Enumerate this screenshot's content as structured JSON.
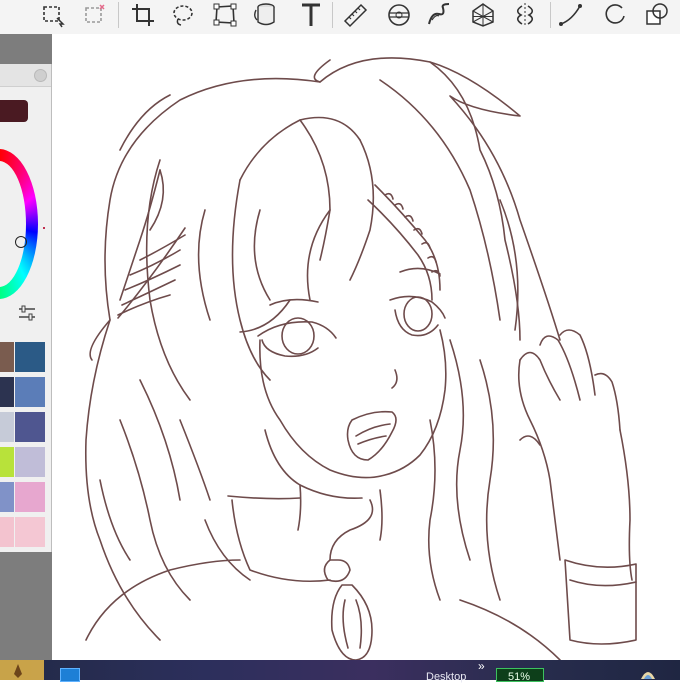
{
  "toolbar": {
    "tools": [
      {
        "icon": "rectangle-select-icon"
      },
      {
        "icon": "rectangle-select-add-icon"
      },
      {
        "icon": "crop-icon"
      },
      {
        "icon": "lasso-select-icon"
      },
      {
        "icon": "transform-icon"
      },
      {
        "icon": "fill-bucket-icon"
      },
      {
        "icon": "text-icon"
      },
      {
        "icon": "ruler-icon"
      },
      {
        "icon": "ellipse-guide-icon"
      },
      {
        "icon": "curve-guide-icon"
      },
      {
        "icon": "perspective-guide-icon"
      },
      {
        "icon": "symmetry-icon"
      },
      {
        "icon": "stroke-icon"
      },
      {
        "icon": "circle-shape-icon"
      },
      {
        "icon": "layers-icon"
      }
    ]
  },
  "color_panel": {
    "current_color": "#4a1a22",
    "swatches": [
      [
        "#7a5c4f",
        "#2b5a86"
      ],
      [
        "#2c3350",
        "#5b7db8"
      ],
      [
        "#c6cbd8",
        "#4f5690"
      ],
      [
        "#b8e23a",
        "#c0bdd8"
      ],
      [
        "#8092c8",
        "#e7a7cf"
      ],
      [
        "#f3c3cf",
        "#f4c7d3"
      ]
    ]
  },
  "taskbar": {
    "desktop_label": "Desktop",
    "tray_arrows": "»",
    "battery_percent": "51%"
  },
  "colors": {
    "line_art": "#6e4b4b",
    "canvas_bg": "#ffffff",
    "gray_strip": "#7d7d7d"
  }
}
